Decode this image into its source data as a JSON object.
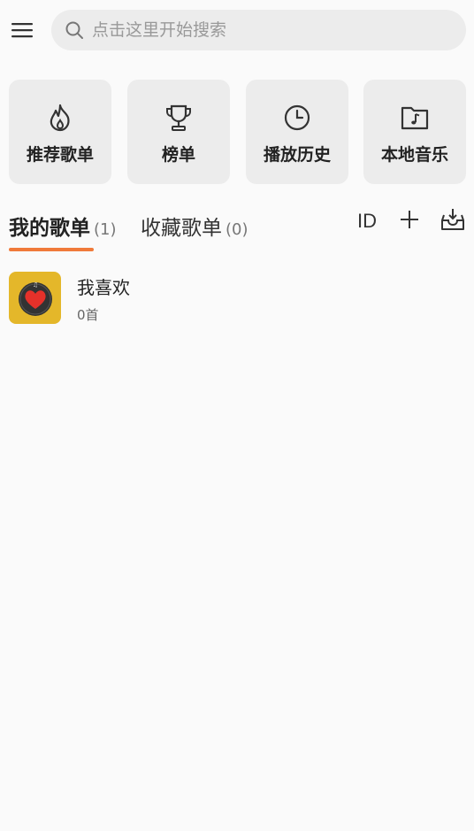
{
  "search": {
    "placeholder": "点击这里开始搜索"
  },
  "quick_actions": [
    {
      "label": "推荐歌单",
      "icon": "flame-icon"
    },
    {
      "label": "榜单",
      "icon": "trophy-icon"
    },
    {
      "label": "播放历史",
      "icon": "clock-icon"
    },
    {
      "label": "本地音乐",
      "icon": "music-folder-icon"
    }
  ],
  "tabs": [
    {
      "label": "我的歌单",
      "count": "(1)",
      "active": true
    },
    {
      "label": "收藏歌单",
      "count": "(0)",
      "active": false
    }
  ],
  "actions": {
    "id_label": "ID"
  },
  "playlists": [
    {
      "name": "我喜欢",
      "count": "0首"
    }
  ],
  "colors": {
    "accent": "#f07a3a",
    "cover": "#e4b72a",
    "heart": "#e5312a"
  }
}
